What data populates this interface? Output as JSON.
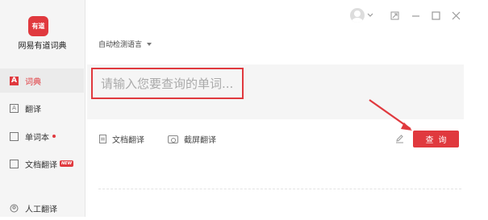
{
  "app": {
    "logo_text": "有道",
    "name": "网易有道词典"
  },
  "sidebar": {
    "items": [
      {
        "label": "词典",
        "icon": "dict-icon",
        "icon_glyph": "A",
        "active": true
      },
      {
        "label": "翻译",
        "icon": "translate-icon",
        "icon_glyph": "A"
      },
      {
        "label": "单词本",
        "icon": "wordbook-icon",
        "icon_glyph": "",
        "has_dot": true
      },
      {
        "label": "文档翻译",
        "icon": "doc-translate-icon",
        "icon_glyph": "",
        "badge": "NEW"
      },
      {
        "label": "人工翻译",
        "icon": "human-translate-icon",
        "icon_glyph": ""
      }
    ]
  },
  "titlebar": {
    "buttons": [
      "avatar",
      "mini-mode-icon",
      "minimize-icon",
      "maximize-icon",
      "close-icon"
    ]
  },
  "main": {
    "language_select": "自动检测语言",
    "query_placeholder": "请输入您要查询的单词...",
    "tools": {
      "doc_translate": "文档翻译",
      "screenshot_translate": "截屏翻译"
    },
    "search_button": "查询"
  },
  "colors": {
    "accent": "#e0393e",
    "sidebar_bg": "#f5f5f5",
    "input_bg": "#f5f5f5"
  }
}
